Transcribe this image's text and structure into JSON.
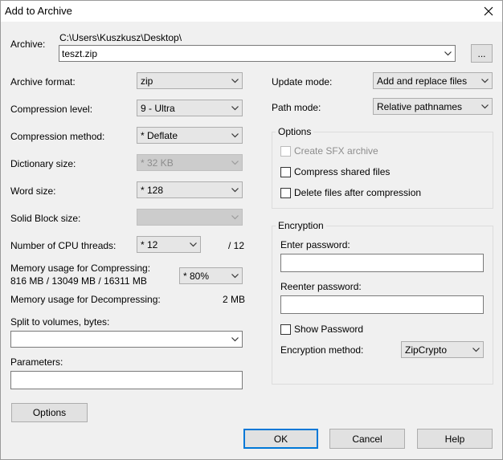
{
  "window": {
    "title": "Add to Archive"
  },
  "archive": {
    "label": "Archive:",
    "path": "C:\\Users\\Kuszkusz\\Desktop\\",
    "filename": "teszt.zip",
    "browse_label": "..."
  },
  "left": {
    "format": {
      "label": "Archive format:",
      "value": "zip"
    },
    "level": {
      "label": "Compression level:",
      "value": "9 - Ultra"
    },
    "method": {
      "label": "Compression method:",
      "value": "* Deflate"
    },
    "dictionary": {
      "label": "Dictionary size:",
      "value": "* 32 KB"
    },
    "word": {
      "label": "Word size:",
      "value": "* 128"
    },
    "solid": {
      "label": "Solid Block size:",
      "value": ""
    },
    "threads": {
      "label": "Number of CPU threads:",
      "value": "* 12",
      "max": "/ 12"
    },
    "mem_compress": {
      "label": "Memory usage for Compressing:",
      "detail": "816 MB / 13049 MB / 16311 MB",
      "value": "* 80%"
    },
    "mem_decompress": {
      "label": "Memory usage for Decompressing:",
      "value": "2 MB"
    },
    "split": {
      "label": "Split to volumes, bytes:",
      "value": ""
    },
    "params": {
      "label": "Parameters:",
      "value": ""
    },
    "options_button": "Options"
  },
  "right": {
    "update": {
      "label": "Update mode:",
      "value": "Add and replace files"
    },
    "path": {
      "label": "Path mode:",
      "value": "Relative pathnames"
    },
    "options": {
      "title": "Options",
      "sfx": "Create SFX archive",
      "shared": "Compress shared files",
      "delete": "Delete files after compression"
    },
    "encryption": {
      "title": "Encryption",
      "enter_label": "Enter password:",
      "reenter_label": "Reenter password:",
      "show": "Show Password",
      "method_label": "Encryption method:",
      "method_value": "ZipCrypto"
    }
  },
  "buttons": {
    "ok": "OK",
    "cancel": "Cancel",
    "help": "Help"
  }
}
